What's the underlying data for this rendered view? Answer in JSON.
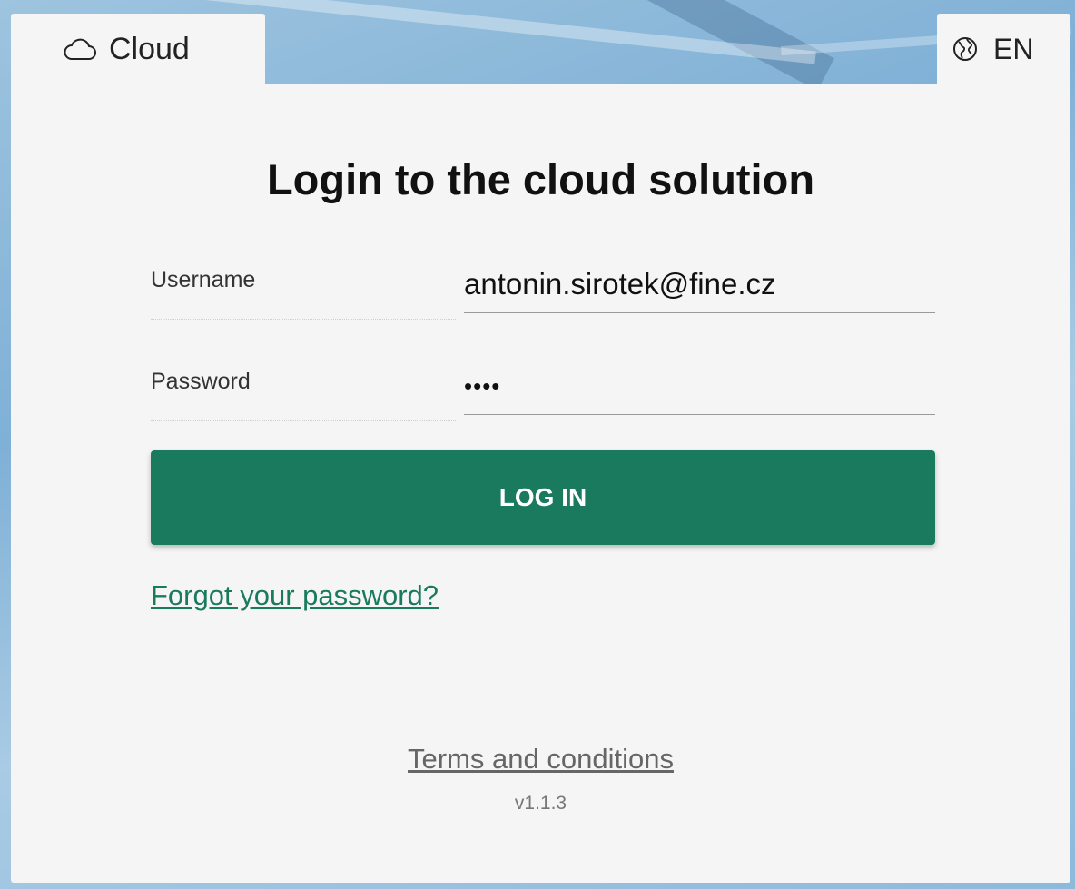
{
  "tabs": {
    "cloud": {
      "label": "Cloud",
      "icon": "cloud-icon"
    },
    "language": {
      "label": "EN",
      "icon": "globe-icon"
    }
  },
  "login": {
    "title": "Login to the cloud solution",
    "username_label": "Username",
    "username_value": "antonin.sirotek@fine.cz",
    "password_label": "Password",
    "password_value": "1234",
    "button_label": "LOG IN",
    "forgot_link": "Forgot your password?"
  },
  "footer": {
    "terms_link": "Terms and conditions",
    "version": "v1.1.3"
  },
  "colors": {
    "accent": "#1a7a5e",
    "panel": "#f5f5f5"
  }
}
